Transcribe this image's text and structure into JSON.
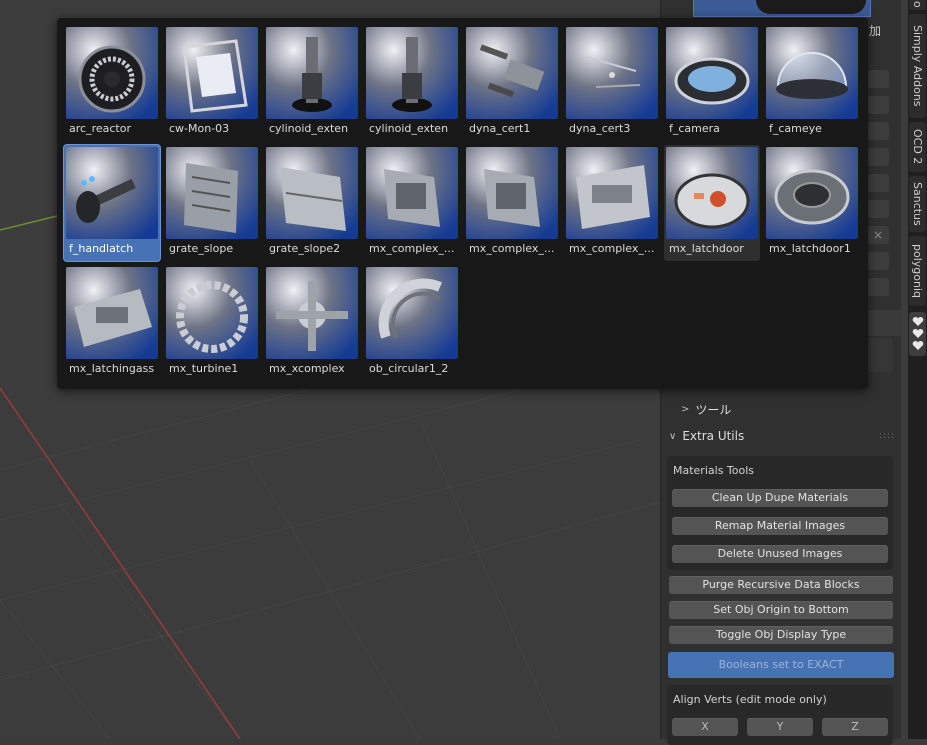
{
  "asset_browser": {
    "assets": [
      {
        "name": "arc_reactor",
        "icon": "ring-disc-thumbnail"
      },
      {
        "name": "cw-Mon-03",
        "icon": "monitor-frame-thumbnail"
      },
      {
        "name": "cylinoid_exten",
        "icon": "cylinder-tower-thumbnail"
      },
      {
        "name": "cylinoid_exten",
        "icon": "cylinder-tower-thumbnail"
      },
      {
        "name": "dyna_cert1",
        "icon": "panel-pieces-thumbnail"
      },
      {
        "name": "dyna_cert3",
        "icon": "scattered-pieces-thumbnail"
      },
      {
        "name": "f_camera",
        "icon": "lens-thumbnail"
      },
      {
        "name": "f_cameye",
        "icon": "glass-dome-thumbnail"
      },
      {
        "name": "f_handlatch",
        "icon": "handle-latch-thumbnail",
        "selected": true
      },
      {
        "name": "grate_slope",
        "icon": "grate-thumbnail"
      },
      {
        "name": "grate_slope2",
        "icon": "slope-plate-thumbnail"
      },
      {
        "name": "mx_complex_...",
        "icon": "complex-block-thumbnail"
      },
      {
        "name": "mx_complex_...",
        "icon": "complex-block-thumbnail"
      },
      {
        "name": "mx_complex_...",
        "icon": "complex-plate-thumbnail"
      },
      {
        "name": "mx_latchdoor",
        "icon": "latch-door-thumbnail",
        "hovered": true
      },
      {
        "name": "mx_latchdoor1",
        "icon": "latch-door-ring-thumbnail"
      },
      {
        "name": "mx_latchingass",
        "icon": "latching-plate-thumbnail"
      },
      {
        "name": "mx_turbine1",
        "icon": "turbine-ring-thumbnail"
      },
      {
        "name": "mx_xcomplex",
        "icon": "cross-complex-thumbnail"
      },
      {
        "name": "ob_circular1_2",
        "icon": "arc-segment-thumbnail"
      }
    ]
  },
  "side_panel": {
    "add_label": "加",
    "close_glyph": "×",
    "tools_section": "ツール",
    "extra_utils_section": "Extra Utils",
    "drag_handle": "::::",
    "materials_tools": {
      "title": "Materials Tools",
      "buttons": [
        "Clean Up Dupe Materials",
        "Remap Material Images",
        "Delete Unused Images"
      ]
    },
    "buttons": [
      "Purge Recursive Data Blocks",
      "Set Obj Origin to Bottom",
      "Toggle Obj Display Type"
    ],
    "booleans_button": "Booleans set to EXACT",
    "align_verts": {
      "title": "Align Verts (edit mode only)",
      "axes": [
        "X",
        "Y",
        "Z"
      ]
    }
  },
  "tool_tabs": [
    "o",
    "Simply Addons",
    "OCD 2",
    "Sanctus",
    "polygoniq"
  ],
  "colors": {
    "selection": "#4772b3",
    "x_axis": "#9a3b3b",
    "y_axis": "#6b8e2e",
    "viewport_bg": "#3c3c3c"
  }
}
